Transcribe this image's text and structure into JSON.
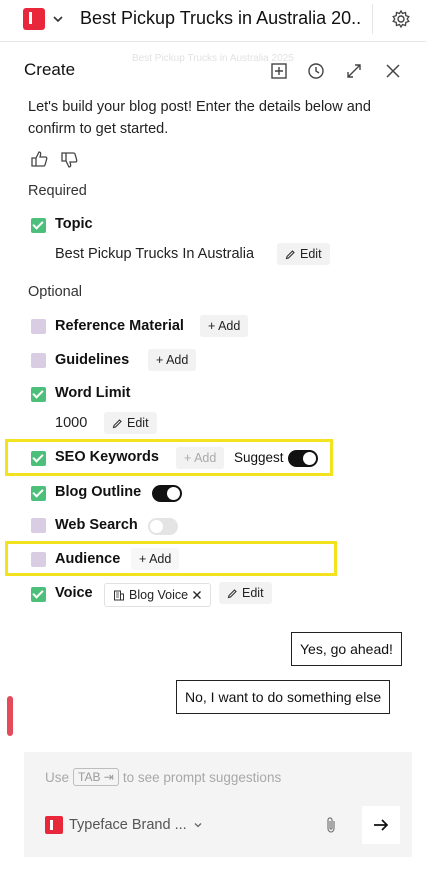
{
  "header": {
    "title": "Best Pickup Trucks in Australia 20...",
    "ghost_title": "Best Pickup Trucks in Australia 2025"
  },
  "panel": {
    "title": "Create",
    "intro": "Let's build your blog post! Enter the details below and confirm to get started."
  },
  "required": {
    "label": "Required",
    "topic": {
      "label": "Topic",
      "checked": true,
      "value": "Best Pickup Trucks In Australia",
      "edit_label": "Edit"
    }
  },
  "optional": {
    "label": "Optional",
    "reference_material": {
      "label": "Reference Material",
      "checked": false,
      "add_label": "+ Add"
    },
    "guidelines": {
      "label": "Guidelines",
      "checked": false,
      "add_label": "+ Add"
    },
    "word_limit": {
      "label": "Word Limit",
      "checked": true,
      "value": "1000",
      "edit_label": "Edit"
    },
    "seo_keywords": {
      "label": "SEO Keywords",
      "checked": true,
      "add_label": "+ Add",
      "suggest_label": "Suggest",
      "suggest_on": true
    },
    "blog_outline": {
      "label": "Blog Outline",
      "checked": true,
      "toggle_on": true
    },
    "web_search": {
      "label": "Web Search",
      "checked": false,
      "toggle_on": false
    },
    "audience": {
      "label": "Audience",
      "checked": false,
      "add_label": "+ Add"
    },
    "voice": {
      "label": "Voice",
      "checked": true,
      "voice_name": "Blog Voice",
      "edit_label": "Edit"
    }
  },
  "replies": {
    "yes": "Yes, go ahead!",
    "no": "No, I want to do something else"
  },
  "composer": {
    "placeholder_prefix": "Use",
    "placeholder_key": "TAB ⇥",
    "placeholder_suffix": "to see prompt suggestions",
    "brand": "Typeface Brand ..."
  },
  "colors": {
    "accent": "#e8273b",
    "check_on": "#4cbf7a",
    "check_off": "#d9cde3",
    "highlight": "#f2e21f"
  }
}
